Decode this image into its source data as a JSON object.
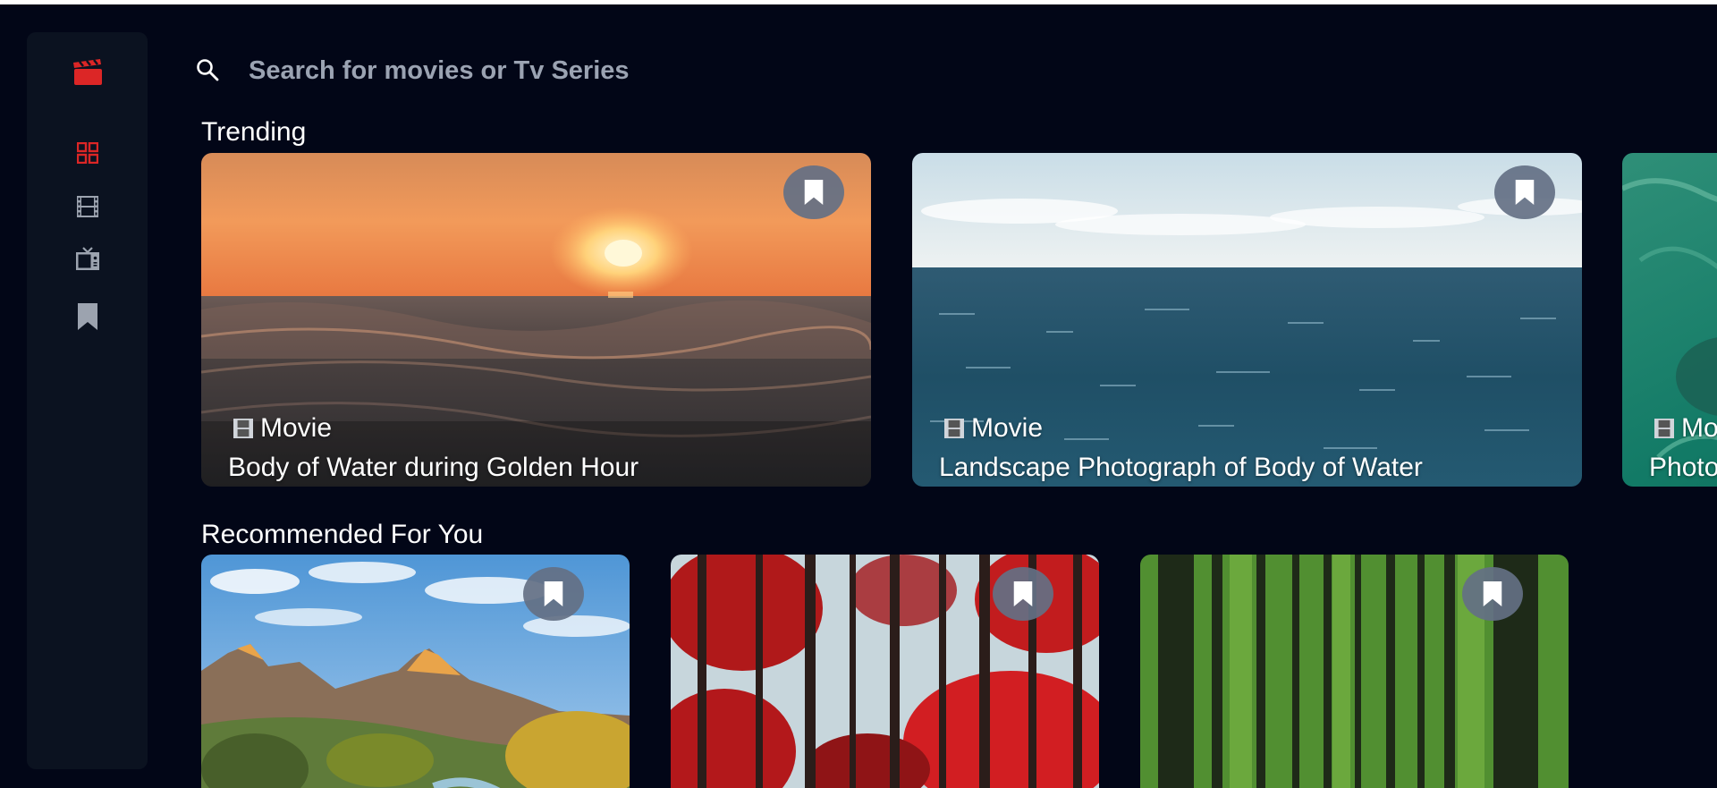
{
  "search": {
    "placeholder": "Search for movies or Tv Series",
    "value": ""
  },
  "sidebar": {
    "items": [
      {
        "icon": "clapperboard-icon",
        "color": "#dc2626"
      },
      {
        "icon": "grid-icon",
        "color": "#dc2626",
        "active": true
      },
      {
        "icon": "film-icon",
        "color": "#9ca3af"
      },
      {
        "icon": "tv-icon",
        "color": "#9ca3af"
      },
      {
        "icon": "bookmark-icon",
        "color": "#9ca3af"
      }
    ]
  },
  "trending": {
    "title": "Trending",
    "cards": [
      {
        "category": "Movie",
        "title": "Body of Water during Golden Hour"
      },
      {
        "category": "Movie",
        "title": "Landscape Photograph of Body of Water"
      },
      {
        "category": "Movie",
        "title": "Photograph of Underwater Turtle"
      }
    ]
  },
  "recommended": {
    "title": "Recommended For You",
    "cards": [
      {
        "image": "mountain-canyon"
      },
      {
        "image": "red-autumn-forest"
      },
      {
        "image": "green-pine-forest"
      }
    ]
  },
  "colors": {
    "background": "#020617",
    "sidebar": "#0b1220",
    "accent": "#dc2626",
    "icon_inactive": "#9ca3af",
    "bookmark_bg": "#647084"
  }
}
